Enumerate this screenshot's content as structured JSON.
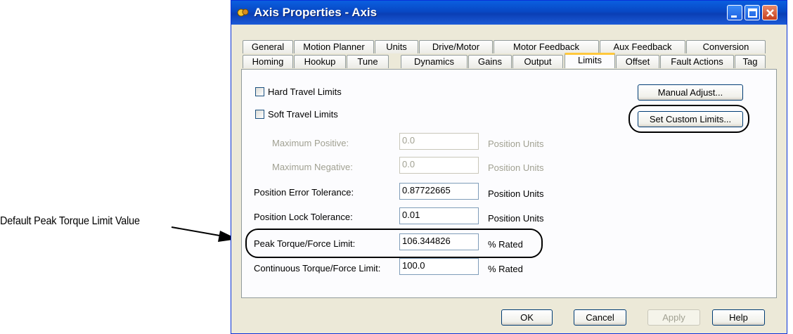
{
  "callout": {
    "text": "Default Peak Torque Limit Value"
  },
  "window": {
    "title": "Axis Properties - Axis"
  },
  "tabs_row1": [
    "General",
    "Motion Planner",
    "Units",
    "Drive/Motor",
    "Motor Feedback",
    "Aux Feedback",
    "Conversion"
  ],
  "tabs_row2": [
    "Homing",
    "Hookup",
    "Tune",
    "Dynamics",
    "Gains",
    "Output",
    "Limits",
    "Offset",
    "Fault Actions",
    "Tag"
  ],
  "active_tab": "Limits",
  "limits": {
    "hard_travel": {
      "label": "Hard Travel Limits",
      "checked": false
    },
    "soft_travel": {
      "label": "Soft Travel Limits",
      "checked": false
    },
    "max_positive": {
      "label": "Maximum Positive:",
      "value": "0.0",
      "unit": "Position Units"
    },
    "max_negative": {
      "label": "Maximum Negative:",
      "value": "0.0",
      "unit": "Position Units"
    },
    "pos_error_tol": {
      "label": "Position Error Tolerance:",
      "value": "0.87722665",
      "unit": "Position Units"
    },
    "pos_lock_tol": {
      "label": "Position Lock Tolerance:",
      "value": "0.01",
      "unit": "Position Units"
    },
    "peak_torque": {
      "label": "Peak Torque/Force Limit:",
      "value": "106.344826",
      "unit": "% Rated"
    },
    "cont_torque": {
      "label": "Continuous Torque/Force Limit:",
      "value": "100.0",
      "unit": "% Rated"
    },
    "manual_adjust": "Manual Adjust...",
    "set_custom": "Set Custom Limits..."
  },
  "footer": {
    "ok": "OK",
    "cancel": "Cancel",
    "apply": "Apply",
    "help": "Help"
  },
  "colors": {
    "titlebar": "#0a5fe0",
    "tab_highlight": "#ffc83c",
    "dialog_bg": "#ece9d8"
  }
}
